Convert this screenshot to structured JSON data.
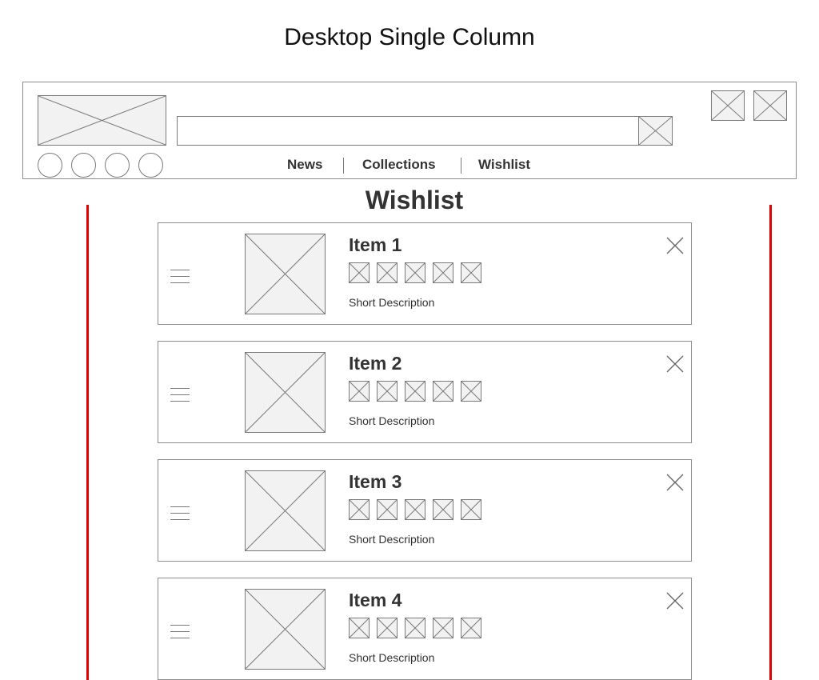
{
  "page": {
    "title": "Desktop Single Column"
  },
  "header": {
    "logo_icon": "image-placeholder-icon",
    "social_icons": [
      "circle-icon",
      "circle-icon",
      "circle-icon",
      "circle-icon"
    ],
    "search": {
      "value": "",
      "button_icon": "image-placeholder-icon"
    },
    "action_icons": [
      "image-placeholder-icon",
      "image-placeholder-icon"
    ],
    "nav": [
      {
        "label": "News"
      },
      {
        "label": "Collections"
      },
      {
        "label": "Wishlist"
      }
    ]
  },
  "wishlist": {
    "heading": "Wishlist",
    "accent_color": "#e00000",
    "items": [
      {
        "title": "Item 1",
        "description": "Short Description",
        "swatch_count": 5
      },
      {
        "title": "Item 2",
        "description": "Short Description",
        "swatch_count": 5
      },
      {
        "title": "Item 3",
        "description": "Short Description",
        "swatch_count": 5
      },
      {
        "title": "Item 4",
        "description": "Short Description",
        "swatch_count": 5
      }
    ]
  }
}
